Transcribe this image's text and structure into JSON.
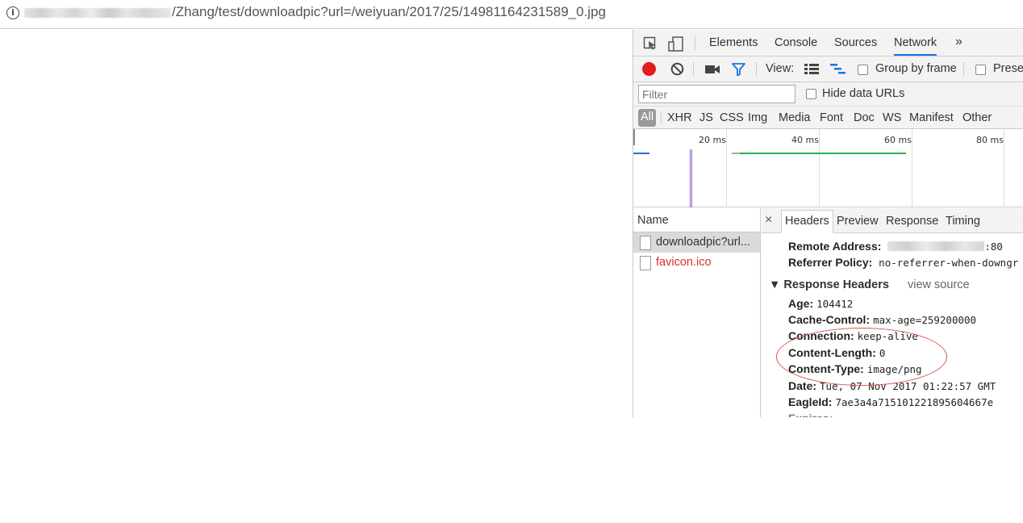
{
  "address_bar": {
    "url_visible": "/Zhang/test/downloadpic?url=/weiyuan/2017/25/14981164231589_0.jpg",
    "info_icon": "info-icon"
  },
  "devtools": {
    "tabs": [
      "Elements",
      "Console",
      "Sources",
      "Network"
    ],
    "more_tabs": "»",
    "active_tab": "Network",
    "toolbar": {
      "view_label": "View:",
      "group_by_frame": "Group by frame",
      "preserve_log": "Preser"
    },
    "filter": {
      "placeholder": "Filter",
      "hide_data_urls": "Hide data URLs"
    },
    "types": [
      "All",
      "XHR",
      "JS",
      "CSS",
      "Img",
      "Media",
      "Font",
      "Doc",
      "WS",
      "Manifest",
      "Other"
    ],
    "timeline": {
      "labels": [
        "20 ms",
        "40 ms",
        "60 ms",
        "80 ms"
      ]
    },
    "requests": {
      "header": "Name",
      "items": [
        {
          "name": "downloadpic?url...",
          "selected": true,
          "color": "#333333"
        },
        {
          "name": "favicon.ico",
          "selected": false,
          "color": "#d93025"
        }
      ]
    },
    "detail": {
      "close": "×",
      "tabs": [
        "Headers",
        "Preview",
        "Response",
        "Timing"
      ],
      "active_tab": "Headers",
      "general": {
        "remote_address_key": "Remote Address:",
        "remote_address_port": ":80",
        "referrer_policy_key": "Referrer Policy:",
        "referrer_policy_val": "no-referrer-when-downgr"
      },
      "response_headers_title": "▼ Response Headers",
      "view_source": "view source",
      "headers": [
        {
          "key": "Age:",
          "value": "104412"
        },
        {
          "key": "Cache-Control:",
          "value": "max-age=259200000"
        },
        {
          "key": "Connection:",
          "value": "keep-alive"
        },
        {
          "key": "Content-Length:",
          "value": "0"
        },
        {
          "key": "Content-Type:",
          "value": "image/png"
        },
        {
          "key": "Date:",
          "value": "Tue, 07 Nov 2017 01:22:57 GMT"
        },
        {
          "key": "EagleId:",
          "value": "7ae3a4a715101221895604667e"
        }
      ]
    }
  }
}
